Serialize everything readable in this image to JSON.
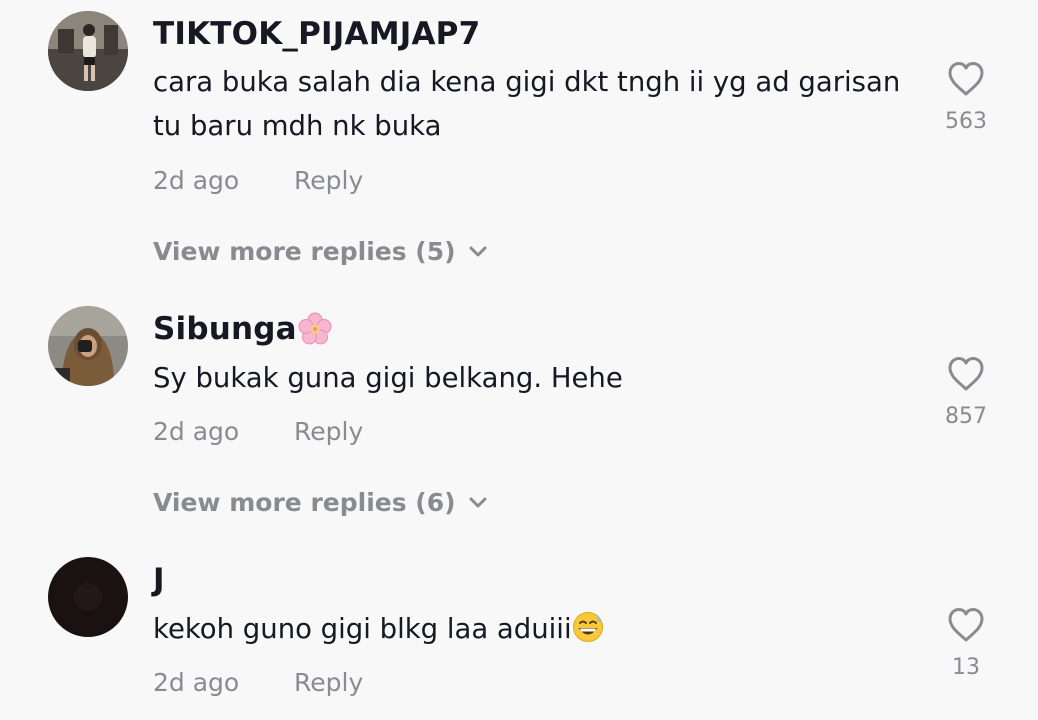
{
  "comments": [
    {
      "username": "TIKTOK_PIJAMJAP7",
      "text": "cara buka salah dia kena gigi dkt tngh ii yg ad garisan tu baru mdh nk buka",
      "time": "2d ago",
      "reply_label": "Reply",
      "likes": "563",
      "more_replies": "View more replies (5)",
      "avatar_icon": "avatar-photo-person"
    },
    {
      "username": "Sibunga",
      "username_emoji": "cherry-blossom-icon",
      "text": "Sy bukak guna gigi belkang. Hehe",
      "time": "2d ago",
      "reply_label": "Reply",
      "likes": "857",
      "more_replies": "View more replies (6)",
      "avatar_icon": "avatar-photo-hijab"
    },
    {
      "username": "J",
      "text": "kekoh guno gigi blkg laa aduiii",
      "text_emoji": "grinning-sweat-icon",
      "time": "2d ago",
      "reply_label": "Reply",
      "likes": "13",
      "avatar_icon": "avatar-dark"
    }
  ],
  "colors": {
    "background": "#f8f8f8",
    "primary_text": "#161823",
    "secondary_text": "#8a8b91"
  }
}
